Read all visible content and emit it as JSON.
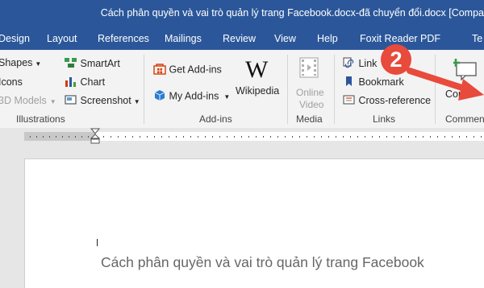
{
  "window": {
    "title": "Cách phân quyền và vai trò quản lý trang Facebook.docx-đã chuyển đổi.docx [Compa"
  },
  "tabs": [
    "Design",
    "Layout",
    "References",
    "Mailings",
    "Review",
    "View",
    "Help",
    "Foxit Reader PDF",
    "Te"
  ],
  "ribbon": {
    "illustrations": {
      "shapes": "Shapes",
      "icons": "Icons",
      "models_3d": "3D Models",
      "smartart": "SmartArt",
      "chart": "Chart",
      "screenshot": "Screenshot",
      "label": "Illustrations"
    },
    "addins": {
      "get": "Get Add-ins",
      "my": "My Add-ins",
      "wikipedia": "Wikipedia",
      "label": "Add-ins"
    },
    "media": {
      "online1": "Online",
      "online2": "Video",
      "label": "Media"
    },
    "links": {
      "link": "Link",
      "bookmark": "Bookmark",
      "crossref": "Cross-reference",
      "label": "Links"
    },
    "comments": {
      "comment": "Com",
      "label": "Comment"
    }
  },
  "annotation": {
    "badge": "2",
    "arrow_color": "#e84a3c"
  },
  "document": {
    "heading": "Cách phân quyền và vai trò quản lý trang Facebook"
  }
}
